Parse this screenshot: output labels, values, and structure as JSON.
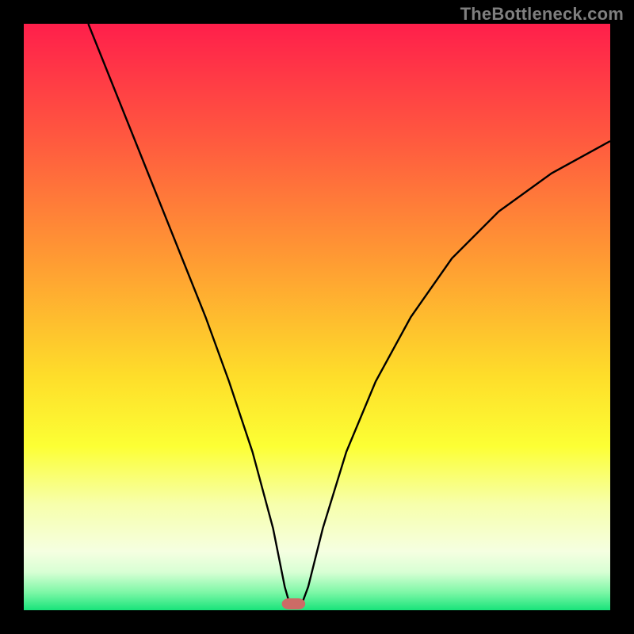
{
  "watermark": "TheBottleneck.com",
  "chart_data": {
    "type": "line",
    "title": "",
    "xlabel": "",
    "ylabel": "",
    "xlim": [
      0,
      100
    ],
    "ylim": [
      0,
      100
    ],
    "notch": {
      "x_start": 44,
      "x_end": 48,
      "y_axis_value": 0
    },
    "gradient_stops": [
      {
        "offset": 0.0,
        "color": "#ff1f4b"
      },
      {
        "offset": 0.2,
        "color": "#ff5a3f"
      },
      {
        "offset": 0.4,
        "color": "#ff9a33"
      },
      {
        "offset": 0.6,
        "color": "#fedd2a"
      },
      {
        "offset": 0.72,
        "color": "#fcff34"
      },
      {
        "offset": 0.82,
        "color": "#f7ffac"
      },
      {
        "offset": 0.9,
        "color": "#f5ffe1"
      },
      {
        "offset": 0.935,
        "color": "#d8ffd4"
      },
      {
        "offset": 0.97,
        "color": "#7cf7a6"
      },
      {
        "offset": 1.0,
        "color": "#18e37a"
      }
    ],
    "curve_points_left": [
      {
        "x": 11,
        "y": 100
      },
      {
        "x": 15,
        "y": 90
      },
      {
        "x": 19,
        "y": 80
      },
      {
        "x": 23,
        "y": 70
      },
      {
        "x": 27,
        "y": 60
      },
      {
        "x": 31,
        "y": 50
      },
      {
        "x": 35,
        "y": 39
      },
      {
        "x": 39,
        "y": 27
      },
      {
        "x": 42.5,
        "y": 14
      },
      {
        "x": 44.5,
        "y": 4
      },
      {
        "x": 45.5,
        "y": 0.5
      }
    ],
    "curve_points_right": [
      {
        "x": 47.2,
        "y": 0.5
      },
      {
        "x": 48.5,
        "y": 4
      },
      {
        "x": 51,
        "y": 14
      },
      {
        "x": 55,
        "y": 27
      },
      {
        "x": 60,
        "y": 39
      },
      {
        "x": 66,
        "y": 50
      },
      {
        "x": 73,
        "y": 60
      },
      {
        "x": 81,
        "y": 68
      },
      {
        "x": 90,
        "y": 74.5
      },
      {
        "x": 100,
        "y": 80
      }
    ],
    "notch_marker": {
      "color": "#cc6b66",
      "rx": 9
    }
  }
}
